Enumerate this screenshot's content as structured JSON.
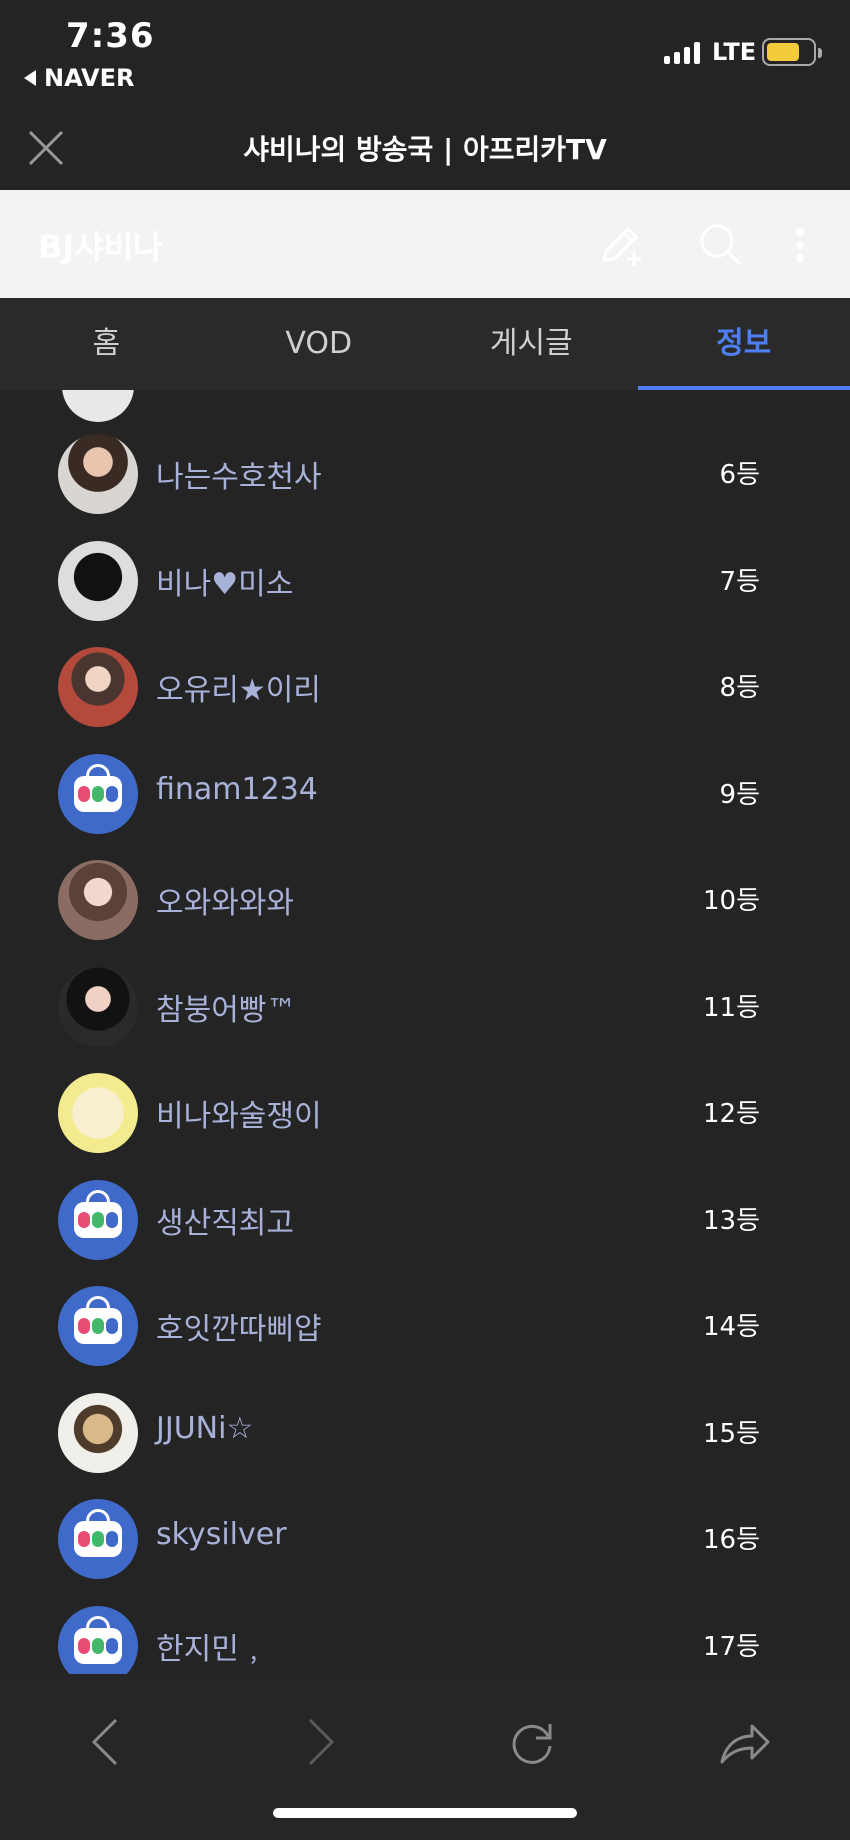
{
  "status_bar": {
    "time": "7:36",
    "back_app": "NAVER",
    "network": "LTE"
  },
  "browser": {
    "page_title": "샤비나의 방송국 | 아프리카TV"
  },
  "header": {
    "title": "BJ샤비나",
    "icons": [
      "edit-add-icon",
      "search-icon",
      "more-vert-icon"
    ]
  },
  "tabs": [
    {
      "label": "홈",
      "active": false
    },
    {
      "label": "VOD",
      "active": false
    },
    {
      "label": "게시글",
      "active": false
    },
    {
      "label": "정보",
      "active": true
    }
  ],
  "rankings": [
    {
      "name": "나는수호천사",
      "rank": "6등",
      "avatar": "photo"
    },
    {
      "name": "비나♥미소",
      "rank": "7등",
      "avatar": "dark"
    },
    {
      "name": "오유리★이리",
      "rank": "8등",
      "avatar": "photo2"
    },
    {
      "name": "finam1234",
      "rank": "9등",
      "avatar": "afreeca"
    },
    {
      "name": "오와와와와",
      "rank": "10등",
      "avatar": "photo3"
    },
    {
      "name": "참붕어빵™",
      "rank": "11등",
      "avatar": "photo4"
    },
    {
      "name": "비나와술쟁이",
      "rank": "12등",
      "avatar": "bunny"
    },
    {
      "name": "생산직최고",
      "rank": "13등",
      "avatar": "afreeca"
    },
    {
      "name": "호잇깐따삐얍",
      "rank": "14등",
      "avatar": "afreeca"
    },
    {
      "name": "JJUNi☆",
      "rank": "15등",
      "avatar": "sketch"
    },
    {
      "name": "skysilver",
      "rank": "16등",
      "avatar": "afreeca"
    },
    {
      "name": "한지민﹐",
      "rank": "17등",
      "avatar": "afreeca"
    }
  ],
  "toolbar": {
    "icons": [
      "back-arrow-icon",
      "forward-arrow-icon",
      "reload-icon",
      "share-icon"
    ]
  },
  "colors": {
    "accent": "#4f7df2",
    "background": "#242424",
    "name_text": "#a8b1d8",
    "afreeca_blue": "#3f6ac9"
  }
}
